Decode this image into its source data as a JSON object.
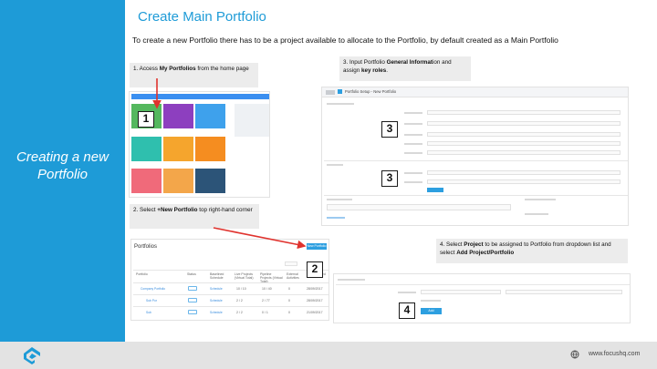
{
  "slide": {
    "side_title": "Creating a new Portfolio",
    "heading": "Create Main Portfolio",
    "intro": "To create a new Portfolio there has to be a project available to allocate to the Portfolio, by default created as a Main Portfolio"
  },
  "steps": {
    "one": {
      "prefix": "1. Access ",
      "bold": "My Portfolios",
      "suffix": " from the home page",
      "marker": "1"
    },
    "two": {
      "prefix": "2. Select ",
      "bold": "+New Portfolio",
      "suffix": " top right-hand corner",
      "marker": "2"
    },
    "three": {
      "prefix": "3. Input Portfolio ",
      "bold": "General Informat",
      "mid": "ion and assign ",
      "bold2": "key roles",
      "suffix": ".",
      "marker": "3"
    },
    "four": {
      "prefix": "4. Select ",
      "bold": "Project",
      "mid": " to be assigned to Portfolio from dropdown list and select ",
      "bold2": "Add Project/Portfolio",
      "suffix": "",
      "marker": "4"
    }
  },
  "screens": {
    "setup_title": "Portfolio Setup - New Portfolio",
    "portfolios_title": "Portfolios",
    "new_portfolio_btn": "New Portfolio",
    "add_btn": "Add Project/Portfolio",
    "table_headers": [
      "Portfolio",
      "Status",
      "Baselined Schedule",
      "Live Projects (Virtual Total)",
      "Pipeline Projects (Virtual Total)",
      "External Activities",
      "Last Updated"
    ],
    "rows": [
      {
        "name": "Company Portfolio",
        "status": "Open",
        "baseline": "Schedule",
        "live": "10 / 10",
        "pipeline": "10 / 40",
        "ext": "0",
        "date": "28/09/2017"
      },
      {
        "name": "Sub Por",
        "status": "Open",
        "baseline": "Schedule",
        "live": "2 / 2",
        "pipeline": "2 / 77",
        "ext": "0",
        "date": "28/09/2017"
      },
      {
        "name": "Sub",
        "status": "Open",
        "baseline": "Schedule",
        "live": "2 / 2",
        "pipeline": "0 / 1",
        "ext": "0",
        "date": "21/09/2017"
      }
    ]
  },
  "footer": {
    "url": "www.focushq.com"
  },
  "colors": {
    "brand_blue": "#1e9bd7",
    "footer_gray": "#e3e3e3",
    "arrow_red": "#e0332e"
  }
}
